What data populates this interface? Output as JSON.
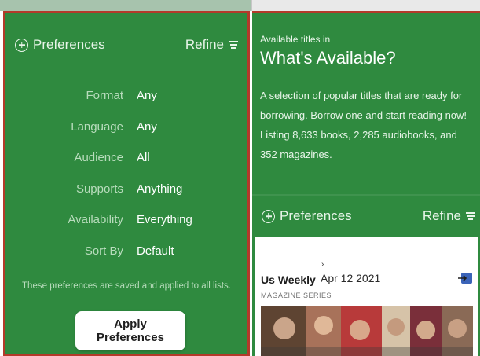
{
  "left_panel": {
    "preferences_label": "Preferences",
    "refine_label": "Refine",
    "rows": [
      {
        "label": "Format",
        "value": "Any"
      },
      {
        "label": "Language",
        "value": "Any"
      },
      {
        "label": "Audience",
        "value": "All"
      },
      {
        "label": "Supports",
        "value": "Anything"
      },
      {
        "label": "Availability",
        "value": "Everything"
      },
      {
        "label": "Sort By",
        "value": "Default"
      }
    ],
    "note": "These preferences are saved and applied to all lists.",
    "apply_label": "Apply Preferences"
  },
  "right_panel": {
    "small_title": "Available titles in",
    "title": "What's Available?",
    "description": "A selection of popular titles that are ready for borrowing. Borrow one and start reading now! Listing 8,633 books, 2,285 audiobooks, and 352 magazines.",
    "preferences_label": "Preferences",
    "refine_label": "Refine",
    "card": {
      "title": "Us Weekly",
      "date": "Apr 12 2021",
      "series": "MAGAZINE SERIES"
    }
  },
  "colors": {
    "panel_green": "#2f8a3f",
    "border_red": "#b33a2a",
    "accent_blue": "#3a63b8"
  }
}
